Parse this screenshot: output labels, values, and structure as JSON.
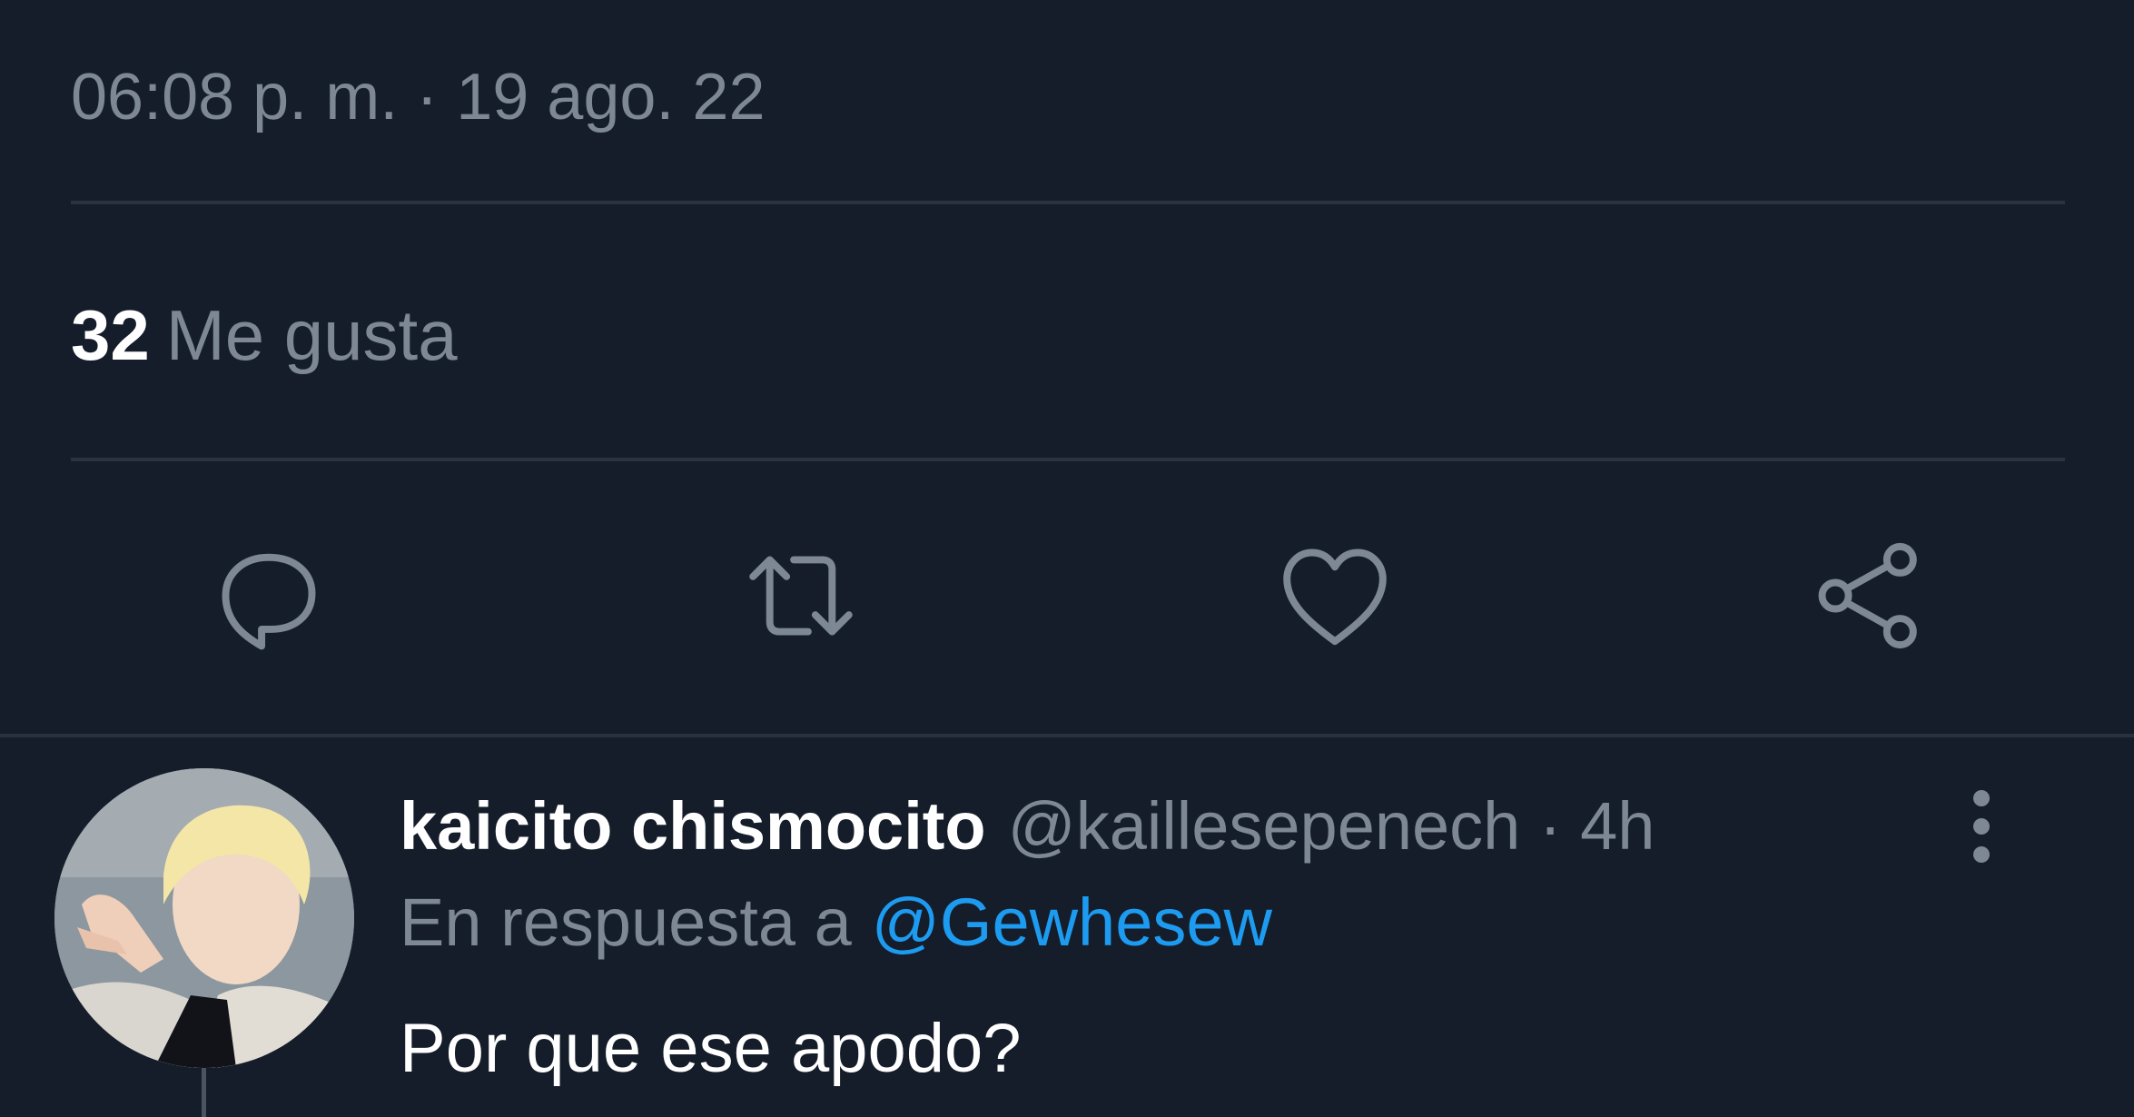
{
  "tweet": {
    "timestamp": "06:08 p. m. · 19 ago. 22",
    "likes_count": "32",
    "likes_label": "Me gusta"
  },
  "actions": [
    {
      "name": "reply",
      "icon": "reply-icon"
    },
    {
      "name": "retweet",
      "icon": "retweet-icon"
    },
    {
      "name": "like",
      "icon": "heart-icon"
    },
    {
      "name": "share",
      "icon": "share-icon"
    }
  ],
  "reply": {
    "display_name": "kaicito chismocito",
    "handle": "@kaillesepenech",
    "time": "· 4h",
    "replying_to_prefix": "En respuesta a",
    "replying_to_user": "@Gewhesew",
    "text": "Por que ese apodo?"
  },
  "colors": {
    "background": "#151d2a",
    "secondary_text": "#7d8894",
    "primary_text": "#ffffff",
    "link": "#1d9bf0",
    "divider": "#2a3441"
  }
}
